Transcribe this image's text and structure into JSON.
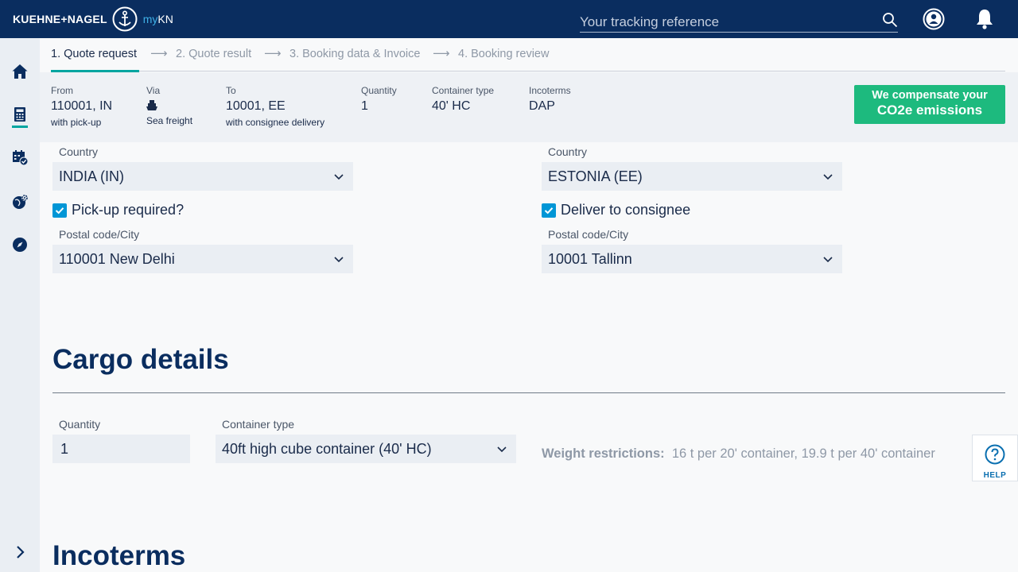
{
  "brand": {
    "name": "KUEHNE+NAGEL",
    "app_prefix": "my",
    "app_suffix": "KN"
  },
  "header": {
    "tracking_placeholder": "Your tracking reference"
  },
  "steps": [
    {
      "label": "1. Quote request",
      "active": true
    },
    {
      "label": "2. Quote result",
      "active": false
    },
    {
      "label": "3. Booking data & Invoice",
      "active": false
    },
    {
      "label": "4. Booking review",
      "active": false
    }
  ],
  "step_arrow": "⟶",
  "summary": {
    "from": {
      "label": "From",
      "value": "110001, IN",
      "sub": "with pick-up"
    },
    "via": {
      "label": "Via",
      "sub": "Sea freight",
      "icon": "ship-icon"
    },
    "to": {
      "label": "To",
      "value": "10001, EE",
      "sub": "with consignee delivery"
    },
    "quantity": {
      "label": "Quantity",
      "value": "1"
    },
    "container_type": {
      "label": "Container type",
      "value": "40' HC"
    },
    "incoterms": {
      "label": "Incoterms",
      "value": "DAP"
    },
    "co2_button": {
      "line1": "We compensate your",
      "line2": "CO2e emissions"
    }
  },
  "origin": {
    "country_label": "Country",
    "country_value": "INDIA (IN)",
    "checkbox_label": "Pick-up required?",
    "checked": true,
    "postal_label": "Postal code/City",
    "postal_value": "110001 New Delhi"
  },
  "destination": {
    "country_label": "Country",
    "country_value": "ESTONIA (EE)",
    "checkbox_label": "Deliver to consignee",
    "checked": true,
    "postal_label": "Postal code/City",
    "postal_value": "10001 Tallinn"
  },
  "cargo": {
    "title": "Cargo details",
    "quantity_label": "Quantity",
    "quantity_value": "1",
    "container_label": "Container type",
    "container_value": "40ft high cube container (40' HC)",
    "weight_label": "Weight restrictions:",
    "weight_text": "16 t per 20' container, 19.9 t per 40' container"
  },
  "incoterms_section": {
    "title": "Incoterms"
  },
  "help": {
    "label": "HELP"
  },
  "colors": {
    "navy": "#0a2d5f",
    "teal": "#00a5a0",
    "green": "#1dba7e",
    "checkbox": "#0096d6"
  },
  "sidebar_icons": [
    "home-icon",
    "calculator-icon",
    "calendar-check-icon",
    "globe-gear-icon",
    "compass-icon",
    "chevron-right-icon"
  ]
}
